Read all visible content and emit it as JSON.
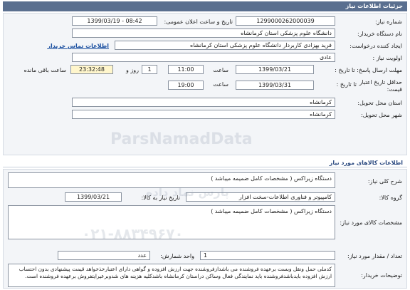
{
  "header": {
    "title": "جزئیات اطلاعات نیاز"
  },
  "need": {
    "number_label": "شماره نیاز:",
    "number_value": "1299000262000039",
    "announce_label": "تاریخ و ساعت اعلان عمومی:",
    "announce_value": "1399/03/19 - 08:42",
    "buyer_label": "نام دستگاه خریدار:",
    "buyer_value": "دانشگاه علوم پزشکی  استان کرمانشاه",
    "creator_label": "ایجاد کننده درخواست:",
    "creator_value": "فرید  بهزادی کاربردار دانشگاه علوم پزشکی  استان کرمانشاه",
    "contact_link": "اطلاعات تماس خریدار",
    "priority_label": "اولویت نیاز :",
    "priority_value": "عادی",
    "deadline_label": "مهلت ارسال پاسخ: تا تاریخ :",
    "deadline_date": "1399/03/21",
    "time_label": "ساعت",
    "deadline_time": "11:00",
    "days_value": "1",
    "day_word": "روز و",
    "remaining_time": "23:32:48",
    "remaining_label": "ساعت باقی مانده",
    "validity_label": "حداقل تاریخ اعتبار",
    "validity_label2": "قیمت:",
    "validity_to": "تا تاریخ :",
    "validity_date": "1399/03/31",
    "validity_time": "19:00",
    "province_label": "استان محل تحویل:",
    "province_value": "کرمانشاه",
    "city_label": "شهر محل تحویل:",
    "city_value": "کرمانشاه"
  },
  "goods": {
    "section_title": "اطلاعات کالاهای مورد نیاز",
    "summary_label": "شرح کلی نیاز:",
    "summary_value": "دستگاه زیراکس ( مشخصات کامل ضمیمه میباشد )",
    "group_label": "گروه کالا:",
    "group_value": "کامپیوتر و فناوری اطلاعات-سخت افزار",
    "need_date_label": "تاریخ نیاز به کالا:",
    "need_date_value": "1399/03/21",
    "spec_label": "مشخصات کالای مورد نیاز:",
    "spec_value": "دستگاه زیراکس ( مشخصات کامل ضمیمه میباشد )",
    "qty_label": "تعداد / مقدار مورد نیاز:",
    "qty_value": "1",
    "unit_label": "واحد شمارش:",
    "unit_value": "عدد",
    "buyer_notes_label": "توضیحات خریدار:",
    "buyer_notes_value": "کدملی حمل ونقل وبست برعهده فروشنده می باشدازفروشنده جهت ارزش افزوده و گواهی دارای اعتبارخذخواهد قیمت پیشنهادی بدون احتساب ارزش افزوده بایدباشدفروشنده باید نمایندگی فعال وساکن دراستان کرمانشاه باشدکلیه هزینه های شدوبرعیرایتفروش برعهده فروشنده است."
  },
  "watermark": {
    "brand": "ParsNamadData",
    "brand_fa": "پارس نماد داده",
    "phone": "۰۲۱-۸۸۳۴۹۶۷۰"
  }
}
